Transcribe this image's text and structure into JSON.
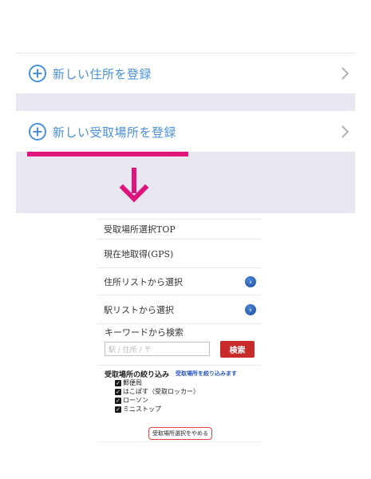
{
  "registration_list": {
    "items": [
      {
        "label": "新しい住所を登録"
      },
      {
        "label": "新しい受取場所を登録"
      }
    ]
  },
  "pickup_screen": {
    "title": "受取場所選択TOP",
    "rows": [
      {
        "label": "現在地取得(GPS)"
      },
      {
        "label": "住所リストから選択"
      },
      {
        "label": "駅リストから選択"
      }
    ],
    "keyword": {
      "label": "キーワードから検索",
      "placeholder": "駅 / 住所 / 〒",
      "search_button": "検索"
    },
    "filter": {
      "title": "受取場所の絞り込み",
      "link": "受取場所を絞り込みます",
      "options": [
        {
          "label": "郵便局",
          "checked": true
        },
        {
          "label": "はこぽす（受取ロッカー）",
          "checked": true
        },
        {
          "label": "ローソン",
          "checked": true
        },
        {
          "label": "ミニストップ",
          "checked": true
        }
      ]
    },
    "cancel_button": "受取場所選択をやめる"
  },
  "colors": {
    "accent_blue": "#4a90d9",
    "arrow_pink": "#e0147d",
    "search_red": "#c92a2a",
    "band_gray": "#e8e6ee"
  }
}
